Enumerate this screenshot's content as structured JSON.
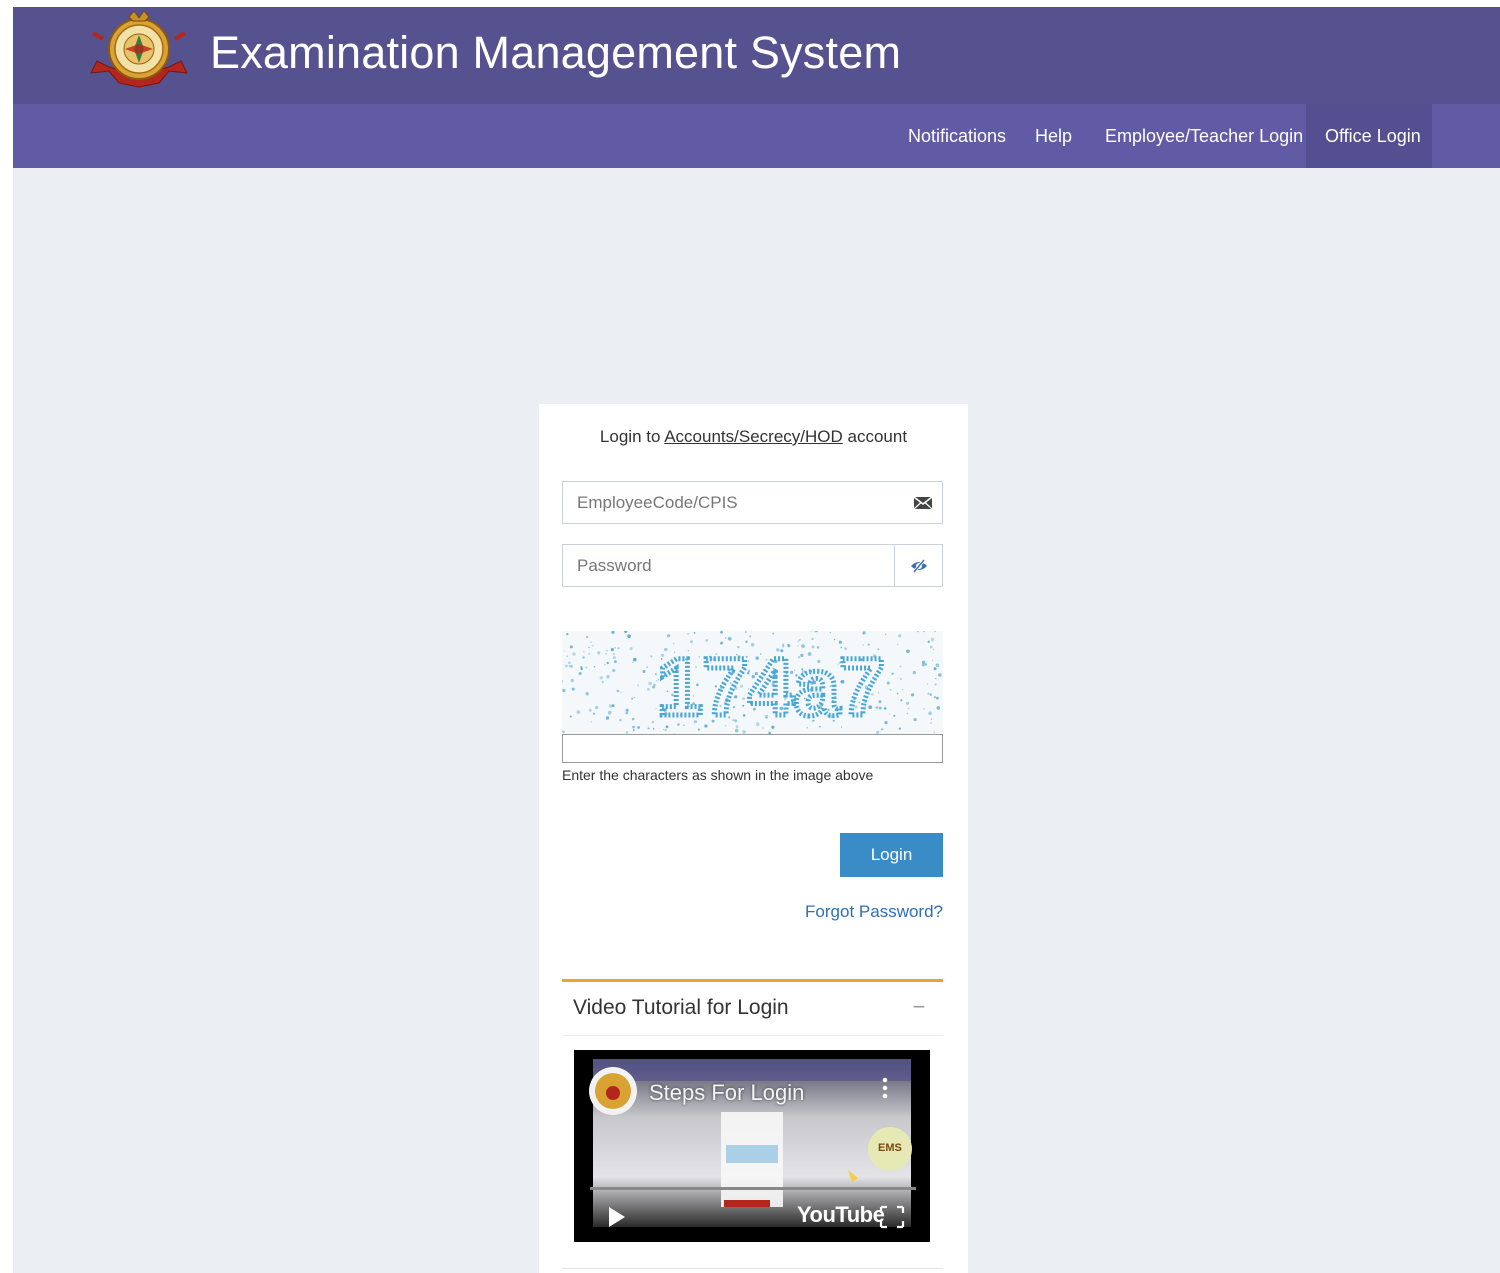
{
  "header": {
    "title": "Examination Management System",
    "logo_icon": "university-seal-icon"
  },
  "nav": {
    "items": [
      {
        "label": "Notifications"
      },
      {
        "label": "Help"
      },
      {
        "label": "Employee/Teacher Login"
      },
      {
        "label": "Office Login",
        "active": true
      }
    ]
  },
  "login": {
    "heading_prefix": "Login to",
    "heading_account": "Accounts/Secrecy/HOD",
    "heading_suffix": "account",
    "employee_placeholder": "EmployeeCode/CPIS",
    "password_placeholder": "Password",
    "captcha_text": "174a7",
    "captcha_value": "",
    "captcha_hint": "Enter the characters as shown in the image above",
    "login_label": "Login",
    "forgot_label": "Forgot Password?"
  },
  "video_panel": {
    "title": "Video Tutorial for Login",
    "collapse_symbol": "−",
    "video_title": "Steps For Login",
    "badge_text": "EMS",
    "youtube_label": "YouTube"
  },
  "colors": {
    "topbar": "#55528f",
    "navbar": "#615ba6",
    "nav_active": "#534f91",
    "page_bg": "#ebeef3",
    "login_button": "#3a8cc6",
    "link": "#2e6fb4",
    "panel_accent": "#f0a030"
  }
}
